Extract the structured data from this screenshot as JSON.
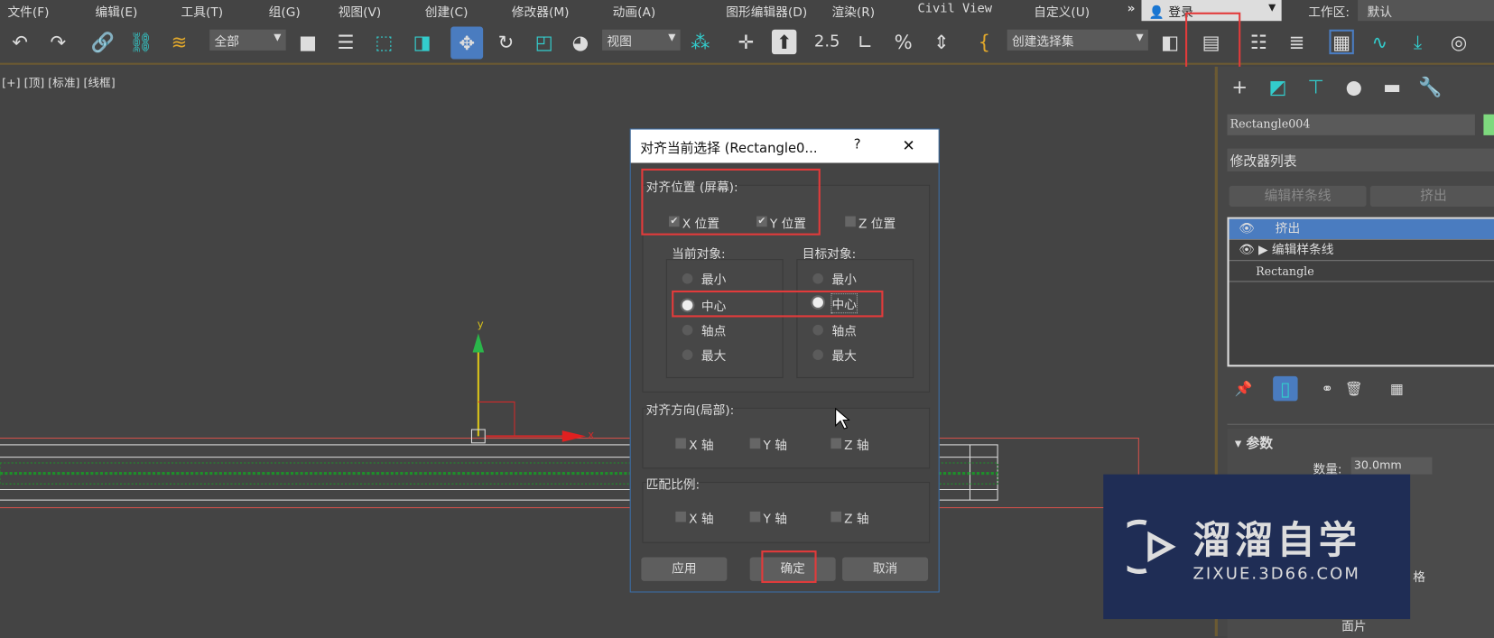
{
  "menu": [
    "文件(F)",
    "编辑(E)",
    "工具(T)",
    "组(G)",
    "视图(V)",
    "创建(C)",
    "修改器(M)",
    "动画(A)",
    "图形编辑器(D)",
    "渲染(R)",
    "Civil View",
    "自定义(U)"
  ],
  "menu_more": "»",
  "login": "登录",
  "workspace_label": "工作区:",
  "workspace_value": "默认",
  "toolbar": {
    "filter": "全部",
    "coord": "视图",
    "selection_set": "创建选择集",
    "snap_label": "2.5"
  },
  "viewport": {
    "label": "[+] [顶] [标准] [线框]",
    "axis_y": "y",
    "axis_x": "x"
  },
  "dialog": {
    "title": "对齐当前选择 (Rectangle0...",
    "help": "?",
    "close": "✕",
    "align_position": "对齐位置 (屏幕):",
    "x_pos": "X 位置",
    "y_pos": "Y 位置",
    "z_pos": "Z 位置",
    "x_checked": true,
    "y_checked": true,
    "z_checked": false,
    "current_object": "当前对象:",
    "target_object": "目标对象:",
    "options": [
      "最小",
      "中心",
      "轴点",
      "最大"
    ],
    "current_selected": "中心",
    "target_selected": "中心",
    "orientation": "对齐方向(局部):",
    "match_scale": "匹配比例:",
    "x_axis": "X 轴",
    "y_axis": "Y 轴",
    "z_axis": "Z 轴",
    "apply": "应用",
    "ok": "确定",
    "cancel": "取消"
  },
  "panel": {
    "object_name": "Rectangle004",
    "object_color": "#7ed97e",
    "modifier_list": "修改器列表",
    "btn_edit_spline": "编辑样条线",
    "btn_extrude": "挤出",
    "stack": [
      "挤出",
      "编辑样条线",
      "Rectangle"
    ],
    "params_title": "参数",
    "amount_label": "数量:",
    "amount_value": "30.0mm",
    "grid_label": "格",
    "patch_label": "面片"
  },
  "watermark": {
    "brand": "溜溜自学",
    "url": "ZIXUE.3D66.COM",
    "bg": "#1f2d55"
  },
  "colors": {
    "highlight": "#e23b3b",
    "selection": "#4a7cc0"
  }
}
